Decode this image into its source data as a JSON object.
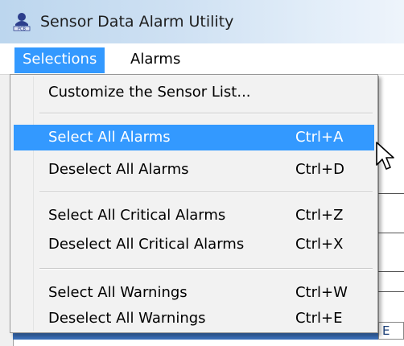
{
  "window": {
    "title": "Sensor Data Alarm Utility",
    "icon": "app-icon"
  },
  "menubar": {
    "items": [
      {
        "label": "Selections",
        "active": true
      },
      {
        "label": "Alarms",
        "active": false
      }
    ]
  },
  "dropdown": {
    "items": [
      {
        "label": "Customize the Sensor List...",
        "shortcut": ""
      },
      {
        "label": "Select All Alarms",
        "shortcut": "Ctrl+A",
        "highlighted": true
      },
      {
        "label": "Deselect All Alarms",
        "shortcut": "Ctrl+D"
      },
      {
        "label": "Select All Critical Alarms",
        "shortcut": "Ctrl+Z"
      },
      {
        "label": "Deselect All Critical Alarms",
        "shortcut": "Ctrl+X"
      },
      {
        "label": "Select All Warnings",
        "shortcut": "Ctrl+W"
      },
      {
        "label": "Deselect All Warnings",
        "shortcut": "Ctrl+E"
      }
    ]
  },
  "background": {
    "partial_cell_text": "E"
  },
  "colors": {
    "highlight": "#3399ff",
    "menu_bg": "#f2f2f2",
    "titlebar": "#bcd6ee"
  }
}
